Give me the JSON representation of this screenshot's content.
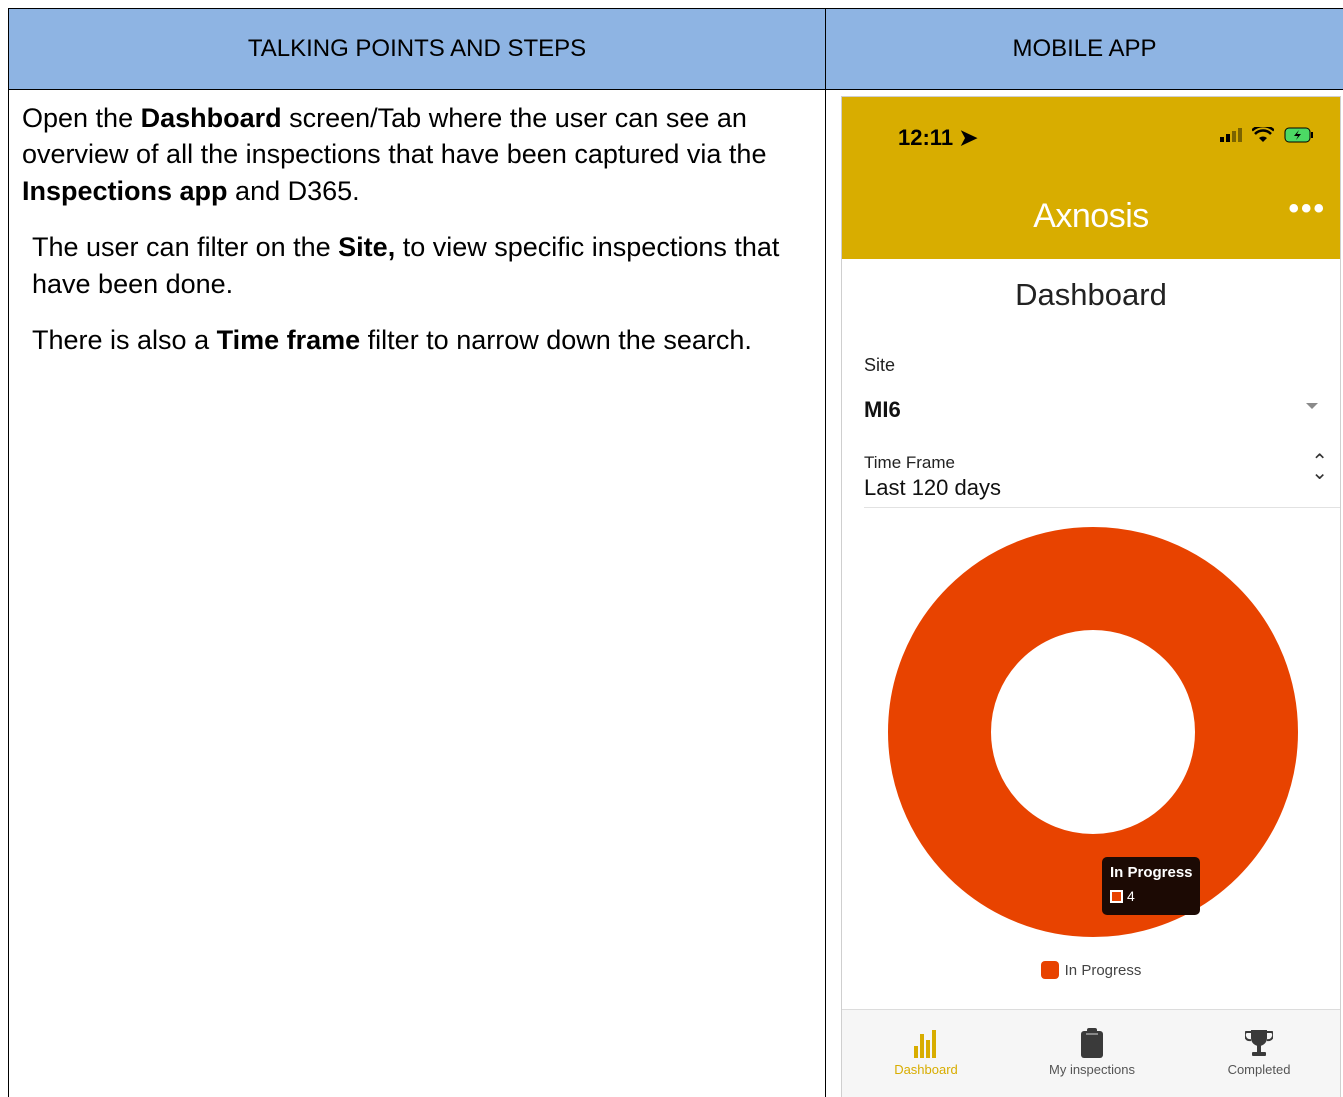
{
  "table": {
    "left_header": "TALKING POINTS AND STEPS",
    "right_header": "MOBILE APP"
  },
  "talking_points": {
    "p1": {
      "t1": "Open the ",
      "b1": "Dashboard",
      "t2": " screen/Tab where the user can see an overview of all the inspections that have been captured via the ",
      "b2": "Inspections app",
      "t3": " and D365."
    },
    "p2": {
      "t1": "The user can filter on the ",
      "b1": "Site,",
      "t2": " to view specific inspections that have been done."
    },
    "p3": {
      "t1": "There is also a ",
      "b1": "Time frame",
      "t2": " filter to narrow down the search."
    }
  },
  "app": {
    "status_time": "12:11",
    "logo": "Axnosis",
    "more_label": "•••",
    "title": "Dashboard",
    "site_label": "Site",
    "site_value": "MI6",
    "timeframe_label": "Time Frame",
    "timeframe_value": "Last 120 days",
    "tabs": [
      {
        "label": "Dashboard",
        "icon": "bar-chart-icon",
        "active": true
      },
      {
        "label": "My inspections",
        "icon": "clipboard-icon",
        "active": false
      },
      {
        "label": "Completed",
        "icon": "trophy-icon",
        "active": false
      }
    ],
    "colors": {
      "brand": "#d8ad00",
      "accent": "#e84300",
      "header": "#8eb4e3"
    }
  },
  "chart_data": {
    "type": "pie",
    "categories": [
      "In Progress"
    ],
    "values": [
      4
    ],
    "legend": [
      "In Progress"
    ],
    "legend_placement": "bottom",
    "data_labels": [
      "4"
    ],
    "tooltip": {
      "title": "In Progress",
      "value": "4"
    }
  }
}
